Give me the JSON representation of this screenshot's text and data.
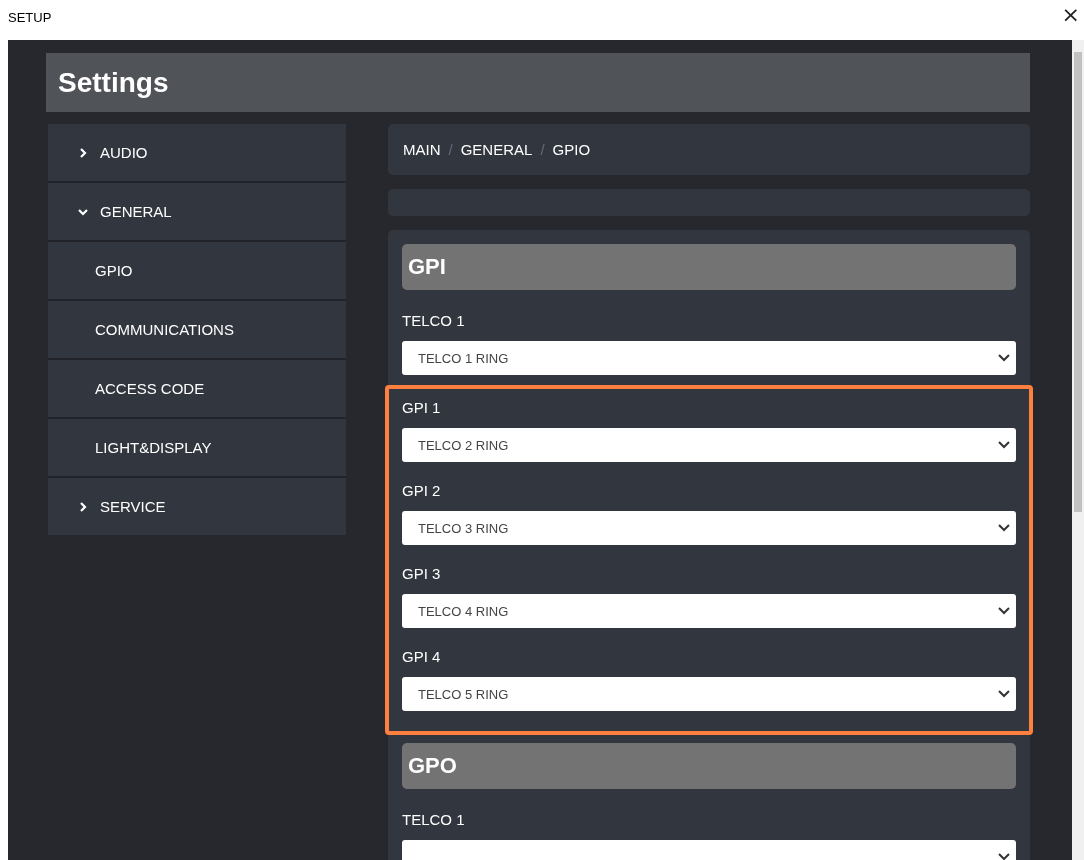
{
  "window": {
    "title": "SETUP",
    "close": "×"
  },
  "header": {
    "title": "Settings"
  },
  "sidebar": {
    "items": [
      {
        "label": "AUDIO",
        "expanded": false
      },
      {
        "label": "GENERAL",
        "expanded": true,
        "children": [
          {
            "label": "GPIO"
          },
          {
            "label": "COMMUNICATIONS"
          },
          {
            "label": "ACCESS CODE"
          },
          {
            "label": "LIGHT&DISPLAY"
          }
        ]
      },
      {
        "label": "SERVICE",
        "expanded": false
      }
    ]
  },
  "breadcrumb": [
    {
      "kind": "crumb",
      "text": "MAIN"
    },
    {
      "kind": "separator",
      "text": "/"
    },
    {
      "kind": "crumb",
      "text": "GENERAL"
    },
    {
      "kind": "separator",
      "text": "/"
    },
    {
      "kind": "crumb",
      "text": "GPIO"
    }
  ],
  "sections": [
    {
      "title": "GPI",
      "fields": [
        {
          "label": "TELCO 1",
          "value": "TELCO 1 RING",
          "highlighted": false
        },
        {
          "label": "GPI 1",
          "value": "TELCO 2 RING",
          "highlighted": true
        },
        {
          "label": "GPI 2",
          "value": "TELCO 3 RING",
          "highlighted": true
        },
        {
          "label": "GPI 3",
          "value": "TELCO 4 RING",
          "highlighted": true
        },
        {
          "label": "GPI 4",
          "value": "TELCO 5 RING",
          "highlighted": true
        }
      ]
    },
    {
      "title": "GPO",
      "fields": [
        {
          "label": "TELCO 1",
          "highlighted": false
        }
      ]
    }
  ]
}
